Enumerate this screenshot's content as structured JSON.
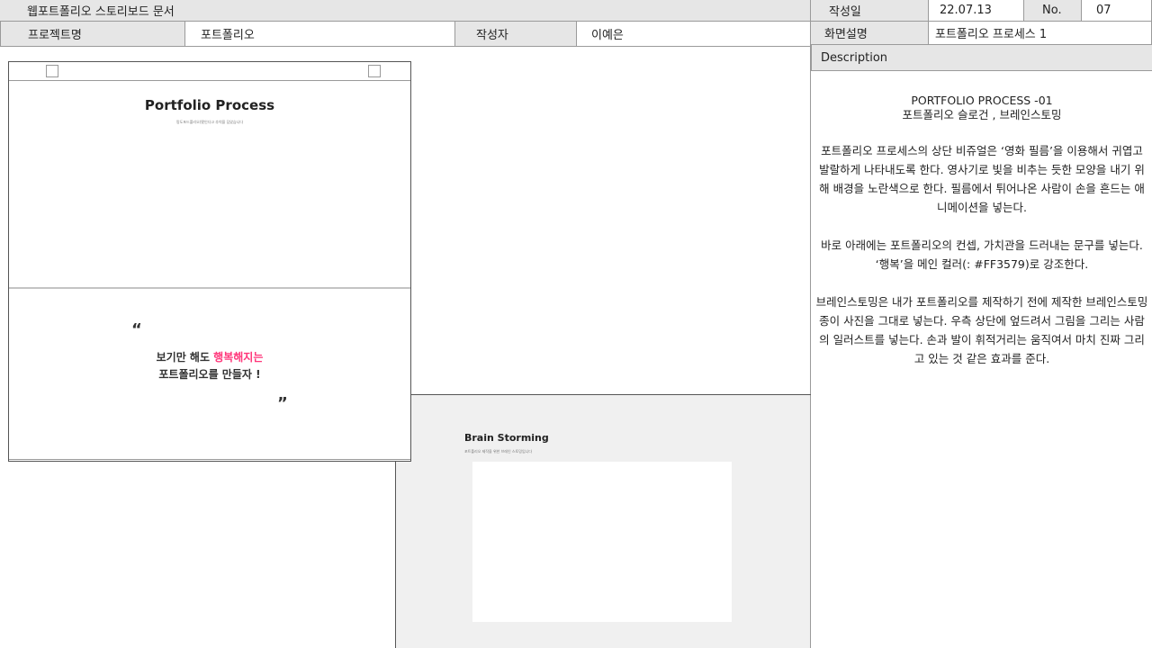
{
  "document": {
    "title": "웹포트폴리오 스토리보드 문서"
  },
  "header": {
    "project_label": "프로젝트명",
    "project_value": "포트폴리오",
    "author_label": "작성자",
    "author_value": "이예은",
    "date_label": "작성일",
    "date_value": "22.07.13",
    "no_label": "No.",
    "no_value": "07",
    "screen_label": "화면설명",
    "screen_value": "포트폴리오 프로세스 1"
  },
  "description": {
    "heading": "Description",
    "title_line1": "PORTFOLIO PROCESS -01",
    "title_line2": "포트폴리오 슬로건 , 브레인스토밍",
    "para1": "포트폴리오 프로세스의 상단 비쥬얼은 ‘영화 필름’을 이용해서 귀엽고 발랄하게 나타내도록 한다. 영사기로 빛을 비추는 듯한 모양을 내기 위해 배경을 노란색으로 한다. 필름에서 튀어나온 사람이 손을 흔드는 애니메이션을 넣는다.",
    "para2": "바로 아래에는 포트폴리오의 컨셉, 가치관을 드러내는 문구를 넣는다. ‘행복’을 메인 컬러(: #FF3579)로 강조한다.",
    "para3": "브레인스토밍은 내가 포트폴리오를 제작하기 전에 제작한 브레인스토밍 종이 사진을 그대로 넣는다. 우측 상단에 엎드려서 그림을 그리는 사람의 일러스트를 넣는다. 손과 발이 휘적거리는 움직여서 마치 진짜 그리고 있는 것 같은 효과를 준다."
  },
  "wireframe1": {
    "title": "Portfolio Process",
    "subtitle": "망도포드폴리오(됐인다고 추억을 담았습니다",
    "quote_open": "“",
    "quote_close": "”",
    "slogan_part1": "보기만 해도 ",
    "slogan_highlight": "행복해지는",
    "slogan_line2": "포트폴리오를 만들자 !"
  },
  "wireframe2": {
    "title": "Brain Storming",
    "subtitle": "포트폴리오 제작을 위한 브레인 스토밍입니다"
  },
  "colors": {
    "accent": "#ff3579",
    "header_bg": "#e6e6e6",
    "frame_bg": "#f0f0f0"
  }
}
